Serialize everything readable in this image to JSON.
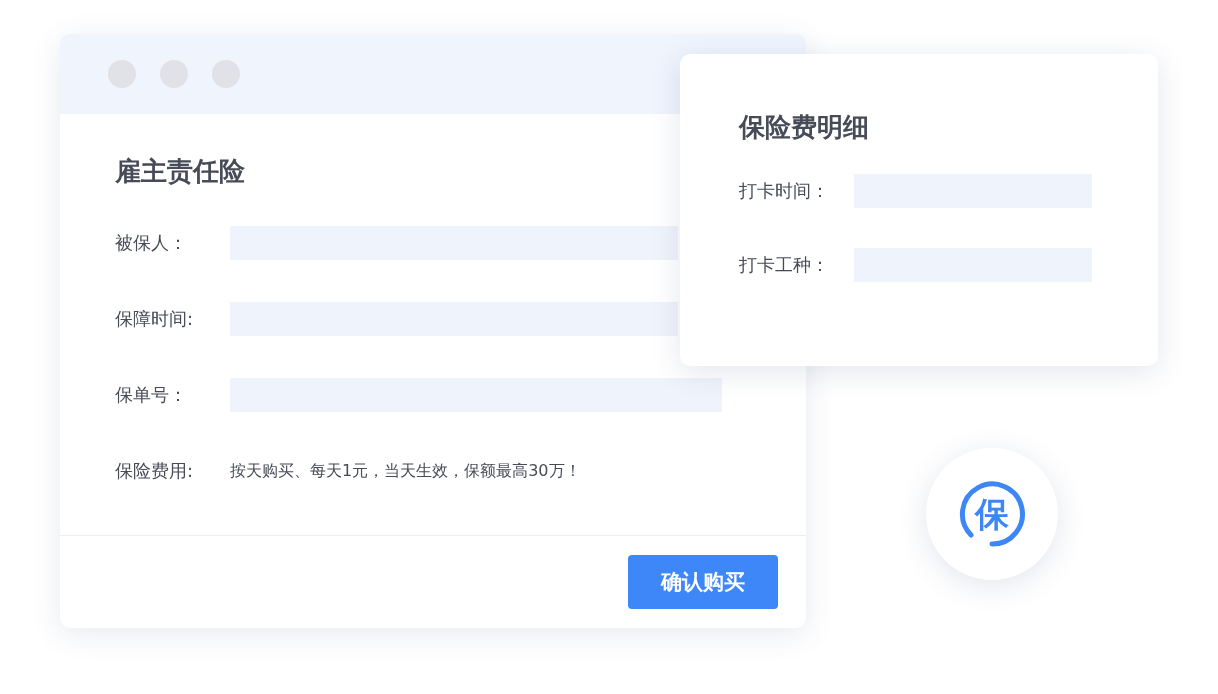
{
  "main_card": {
    "title": "雇主责任险",
    "fields": [
      {
        "kind": "input",
        "label": "被保人："
      },
      {
        "kind": "input",
        "label": "保障时间:"
      },
      {
        "kind": "input",
        "label": "保单号："
      },
      {
        "kind": "text",
        "label": "保险费用:",
        "value": "按天购买、每天1元，当天生效，保额最高30万！"
      }
    ],
    "button": "确认购买"
  },
  "detail_card": {
    "title": "保险费明细",
    "fields": [
      {
        "label": "打卡时间："
      },
      {
        "label": "打卡工种："
      }
    ]
  },
  "badge": {
    "text": "保"
  }
}
